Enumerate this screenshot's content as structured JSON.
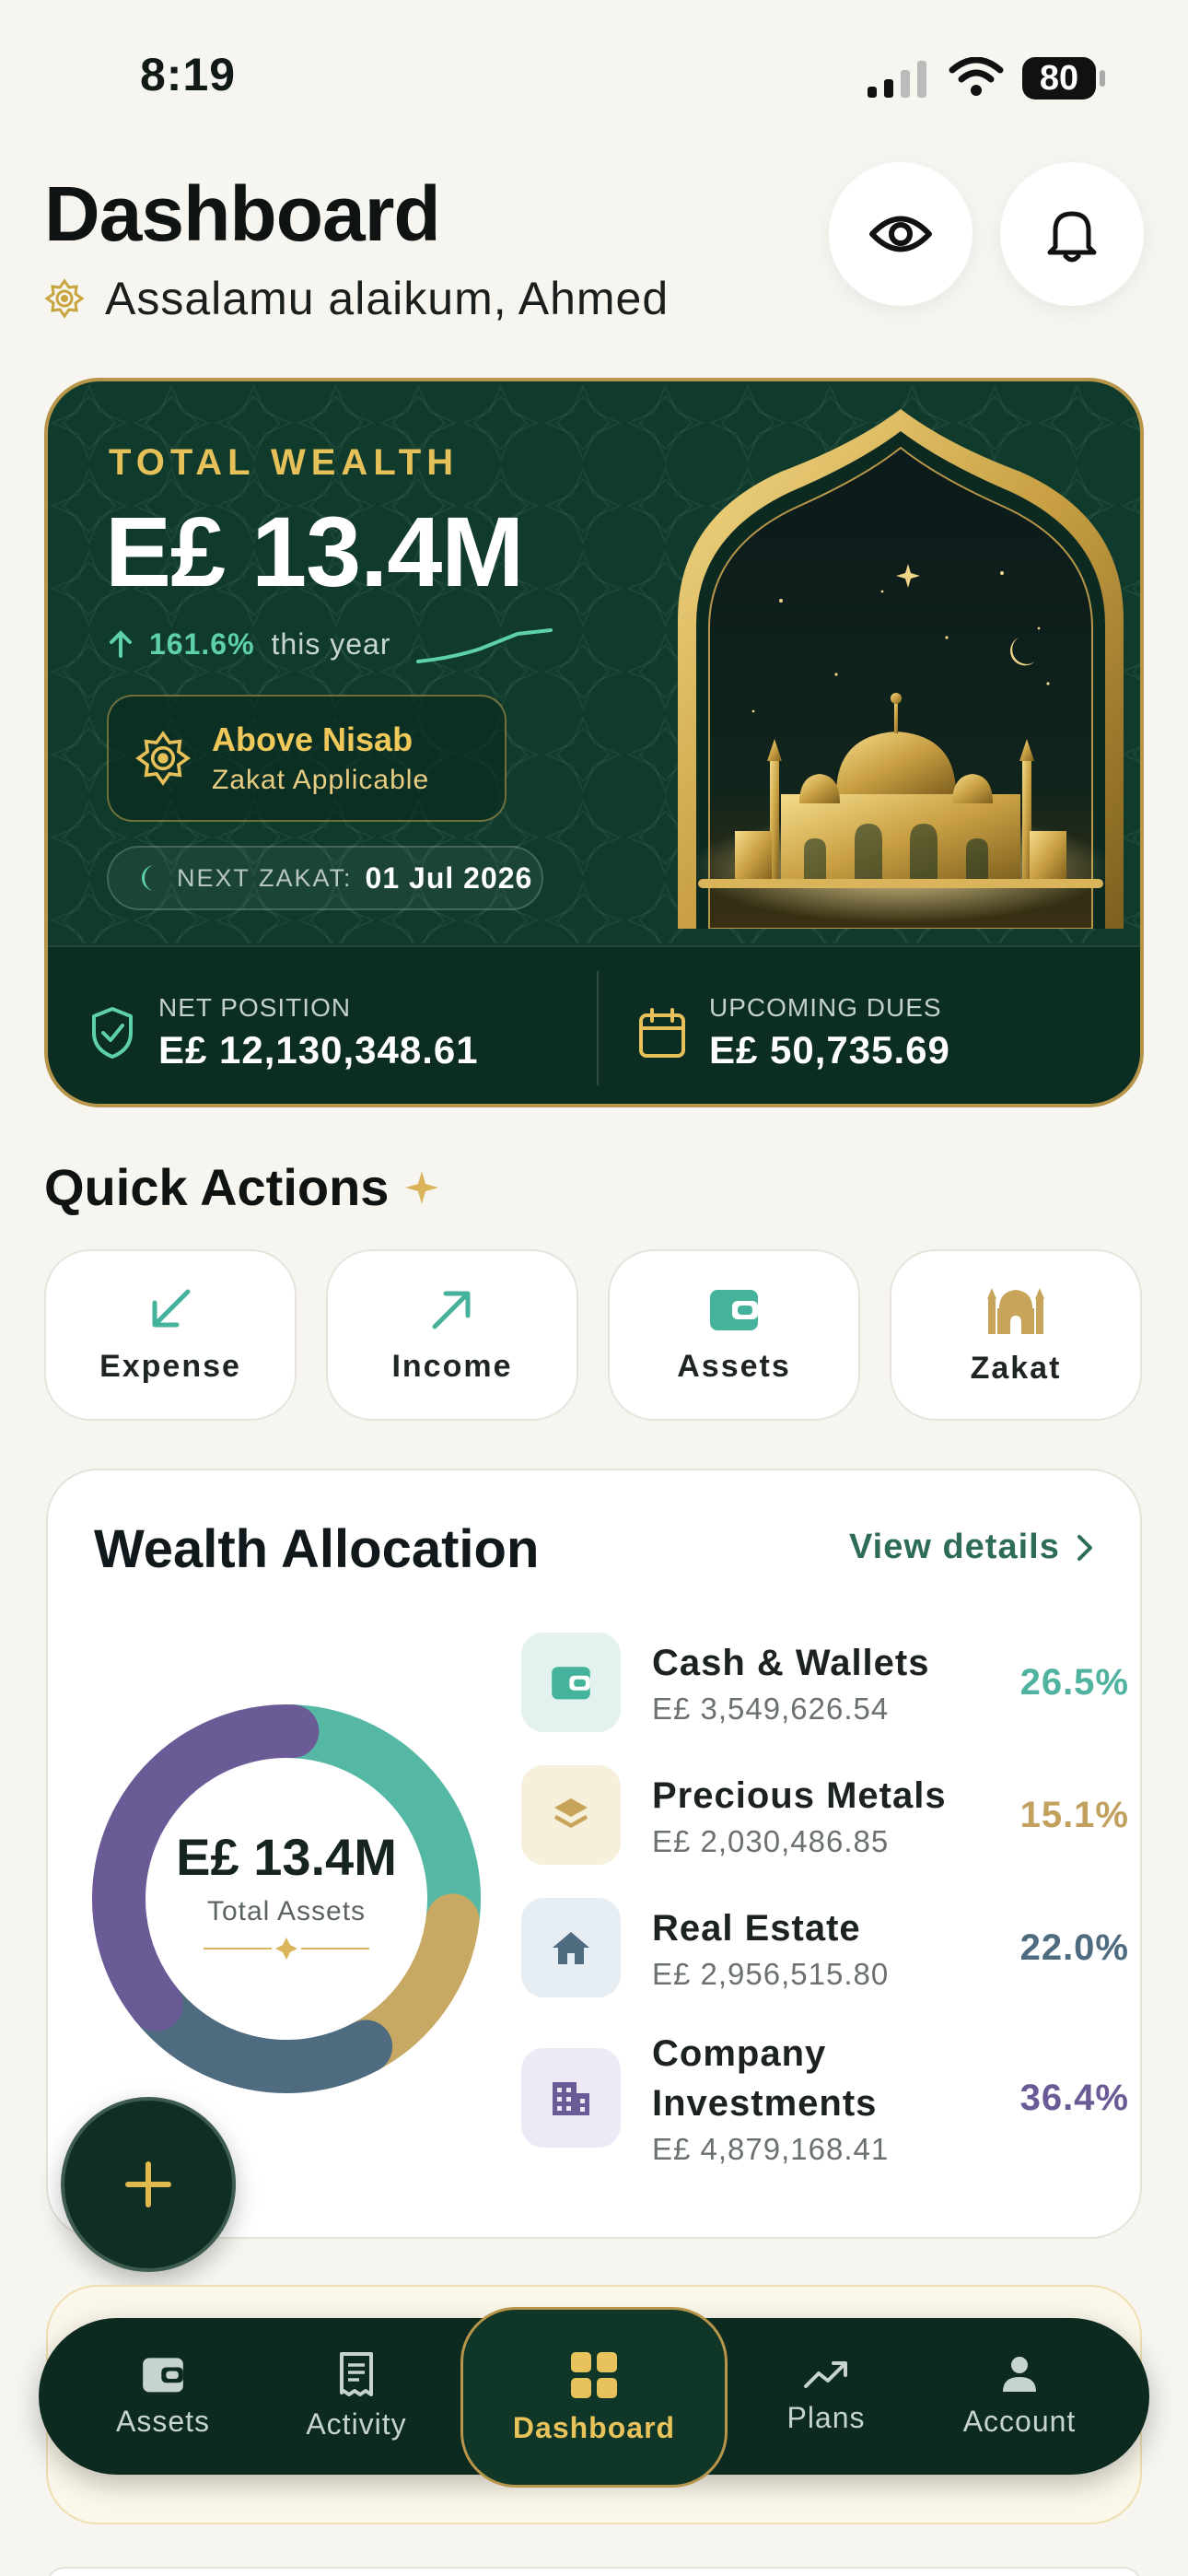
{
  "status_bar": {
    "time": "8:19",
    "battery": "80"
  },
  "header": {
    "title": "Dashboard",
    "greeting": "Assalamu alaikum, Ahmed"
  },
  "wealth_card": {
    "label": "TOTAL WEALTH",
    "amount": "E£ 13.4M",
    "growth_pct": "161.6%",
    "growth_suffix": "this year",
    "nisab_title": "Above Nisab",
    "nisab_sub": "Zakat Applicable",
    "next_zakat_label": "NEXT ZAKAT:",
    "next_zakat_date": "01 Jul 2026",
    "net_position_label": "NET POSITION",
    "net_position_value": "E£ 12,130,348.61",
    "upcoming_dues_label": "UPCOMING DUES",
    "upcoming_dues_value": "E£ 50,735.69"
  },
  "quick_actions": {
    "title": "Quick Actions",
    "items": [
      {
        "label": "Expense",
        "icon": "arrow-down-left-icon"
      },
      {
        "label": "Income",
        "icon": "arrow-up-right-icon"
      },
      {
        "label": "Assets",
        "icon": "wallet-icon"
      },
      {
        "label": "Zakat",
        "icon": "mosque-icon"
      }
    ]
  },
  "allocation": {
    "title": "Wealth Allocation",
    "view_details": "View details",
    "center_amount": "E£ 13.4M",
    "center_label": "Total Assets",
    "colors": {
      "cash": "#55b8a4",
      "metals": "#c8a964",
      "real_estate": "#4f6b80",
      "company": "#6a5a96"
    },
    "items": [
      {
        "name": "Cash & Wallets",
        "amount": "E£ 3,549,626.54",
        "pct": "26.5%",
        "value": 26.5
      },
      {
        "name": "Precious Metals",
        "amount": "E£ 2,030,486.85",
        "pct": "15.1%",
        "value": 15.1
      },
      {
        "name": "Real Estate",
        "amount": "E£ 2,956,515.80",
        "pct": "22.0%",
        "value": 22.0
      },
      {
        "name": "Company Investments",
        "amount": "E£ 4,879,168.41",
        "pct": "36.4%",
        "value": 36.4
      }
    ]
  },
  "bottom_nav": {
    "items": [
      {
        "label": "Assets"
      },
      {
        "label": "Activity"
      },
      {
        "label": "Dashboard",
        "active": true
      },
      {
        "label": "Plans"
      },
      {
        "label": "Account"
      }
    ]
  }
}
